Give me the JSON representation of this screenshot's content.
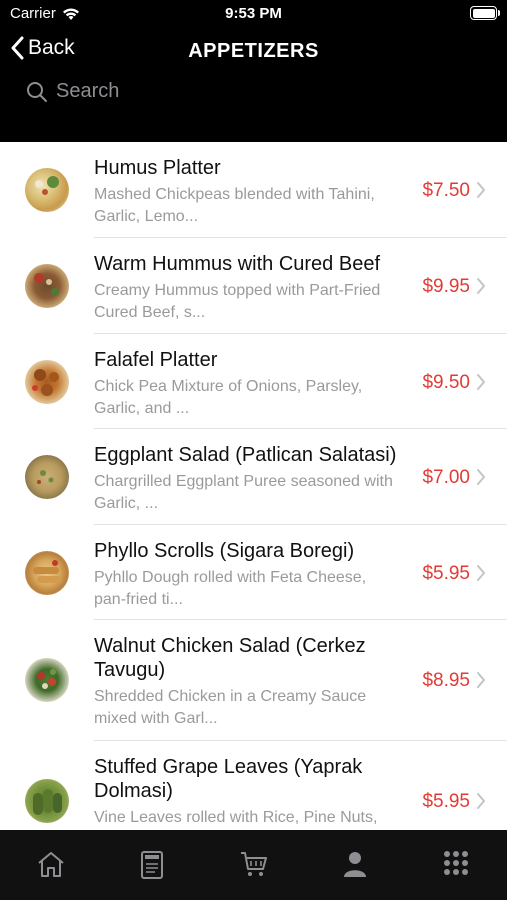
{
  "status": {
    "carrier": "Carrier",
    "time": "9:53 PM"
  },
  "nav": {
    "back_label": "Back",
    "title": "APPETIZERS"
  },
  "search": {
    "placeholder": "Search"
  },
  "items": [
    {
      "name": "Humus Platter",
      "desc": "Mashed Chickpeas blended with Tahini, Garlic, Lemo...",
      "price": "$7.50"
    },
    {
      "name": "Warm Hummus with Cured Beef",
      "desc": "Creamy Hummus topped with Part-Fried Cured Beef, s...",
      "price": "$9.95"
    },
    {
      "name": "Falafel Platter",
      "desc": "Chick Pea Mixture of Onions, Parsley, Garlic, and ...",
      "price": "$9.50"
    },
    {
      "name": "Eggplant Salad (Patlican Salatasi)",
      "desc": "Chargrilled Eggplant Puree seasoned with Garlic, ...",
      "price": "$7.00"
    },
    {
      "name": "Phyllo Scrolls (Sigara Boregi)",
      "desc": "Pyhllo Dough rolled with Feta Cheese, pan-fried ti...",
      "price": "$5.95"
    },
    {
      "name": "Walnut Chicken Salad (Cerkez Tavugu)",
      "desc": "Shredded Chicken in a Creamy Sauce mixed with Garl...",
      "price": "$8.95"
    },
    {
      "name": "Stuffed Grape Leaves (Yaprak Dolmasi)",
      "desc": "Vine Leaves rolled with Rice, Pine Nuts,",
      "price": "$5.95"
    }
  ],
  "colors": {
    "price": "#e23b35",
    "header_bg": "#000000",
    "tabbar_bg": "#111111"
  },
  "tabs": [
    "home-icon",
    "menu-icon",
    "cart-icon",
    "account-icon",
    "more-icon"
  ]
}
